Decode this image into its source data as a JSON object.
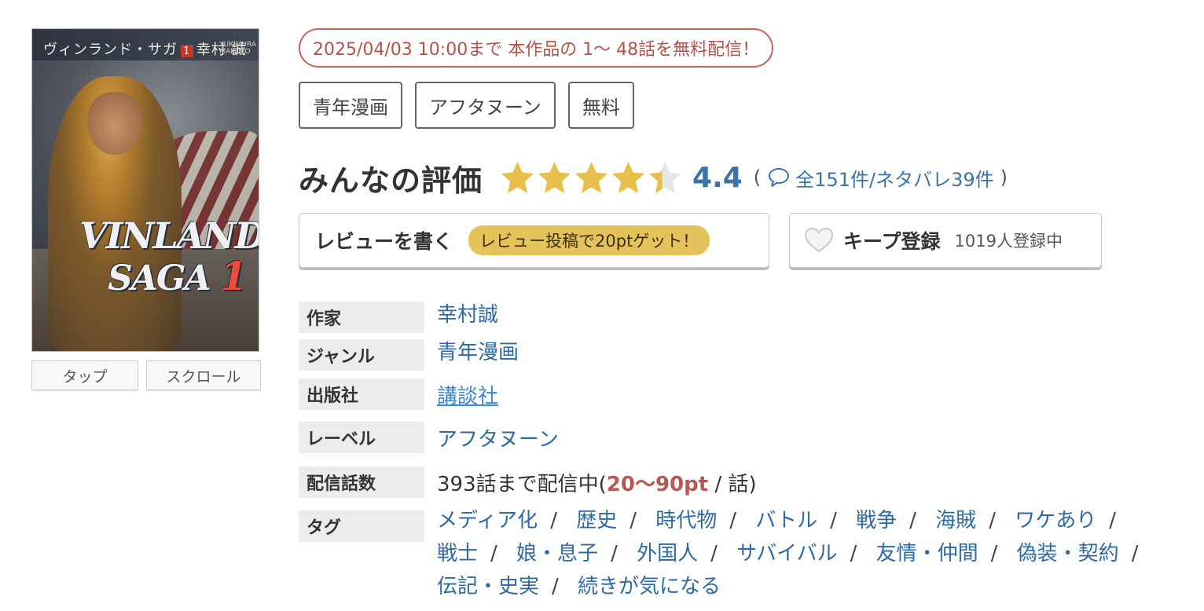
{
  "cover": {
    "title_jp": "ヴィンランド・サガ",
    "volume": "1",
    "author_jp": "幸村 誠",
    "author_romaji": "YUKIMURA MAKOTO",
    "logo_line1": "VINLAND",
    "logo_line2": "SAGA",
    "logo_number": "1"
  },
  "view_buttons": {
    "tap": "タップ",
    "scroll": "スクロール"
  },
  "campaign": "2025/04/03 10:00まで 本作品の 1〜 48話を無料配信！",
  "genre_chips": [
    "青年漫画",
    "アフタヌーン",
    "無料"
  ],
  "rating": {
    "label": "みんなの評価",
    "score": "4.4",
    "score_value": 4.4,
    "max_stars": 5,
    "reviews_text": "全151件/ネタバレ39件",
    "open_paren": "(",
    "close_paren": ")"
  },
  "colors": {
    "star": "#e8bf4a",
    "star_empty": "#e6e6e6",
    "link": "#2d6aa6",
    "score": "#3a73a8",
    "campaign": "#c9605c",
    "price": "#b55a52"
  },
  "actions": {
    "write_review": "レビューを書く",
    "review_bonus": "レビュー投稿で20ptゲット！",
    "keep": "キープ登録",
    "keep_count": "1019人登録中"
  },
  "info": {
    "author_label": "作家",
    "author_value": "幸村誠",
    "genre_label": "ジャンル",
    "genre_value": "青年漫画",
    "publisher_label": "出版社",
    "publisher_value": "講談社",
    "label_label": "レーベル",
    "label_value": "アフタヌーン",
    "episodes_label": "配信話数",
    "episodes_prefix": "393話まで配信中(",
    "episodes_price": "20〜90pt",
    "episodes_suffix": " / 話)",
    "tags_label": "タグ"
  },
  "tags": [
    "メディア化",
    "歴史",
    "時代物",
    "バトル",
    "戦争",
    "海賊",
    "ワケあり",
    "戦士",
    "娘・息子",
    "外国人",
    "サバイバル",
    "友情・仲間",
    "偽装・契約",
    "伝記・史実",
    "続きが気になる"
  ],
  "tag_separator": "/"
}
